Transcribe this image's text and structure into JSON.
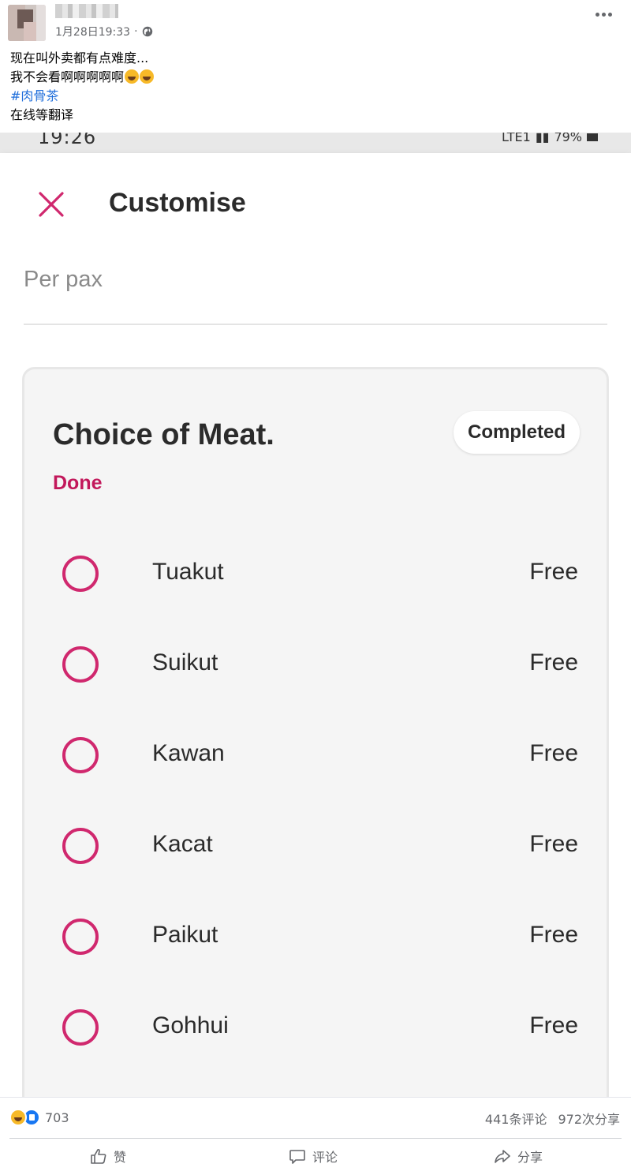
{
  "post": {
    "time": "1月28日19:33",
    "separator": "·",
    "lines": [
      "现在叫外卖都有点难度...",
      "我不会看啊啊啊啊啊"
    ],
    "hashtag": "#肉骨茶",
    "last_line": "在线等翻译"
  },
  "screenshot": {
    "status_time": "19:26",
    "status_network": "LTE1",
    "status_battery": "79%",
    "title": "Customise",
    "per_pax": "Per pax",
    "section": {
      "title": "Choice of Meat.",
      "badge": "Completed",
      "status": "Done",
      "options": [
        {
          "label": "Tuakut",
          "price": "Free"
        },
        {
          "label": "Suikut",
          "price": "Free"
        },
        {
          "label": "Kawan",
          "price": "Free"
        },
        {
          "label": "Kacat",
          "price": "Free"
        },
        {
          "label": "Paikut",
          "price": "Free"
        },
        {
          "label": "Gohhui",
          "price": "Free"
        }
      ]
    },
    "accent_color": "#d0286e"
  },
  "footer": {
    "reaction_count": "703",
    "comments": "441条评论",
    "shares": "972次分享",
    "like_label": "赞",
    "comment_label": "评论",
    "share_label": "分享"
  }
}
